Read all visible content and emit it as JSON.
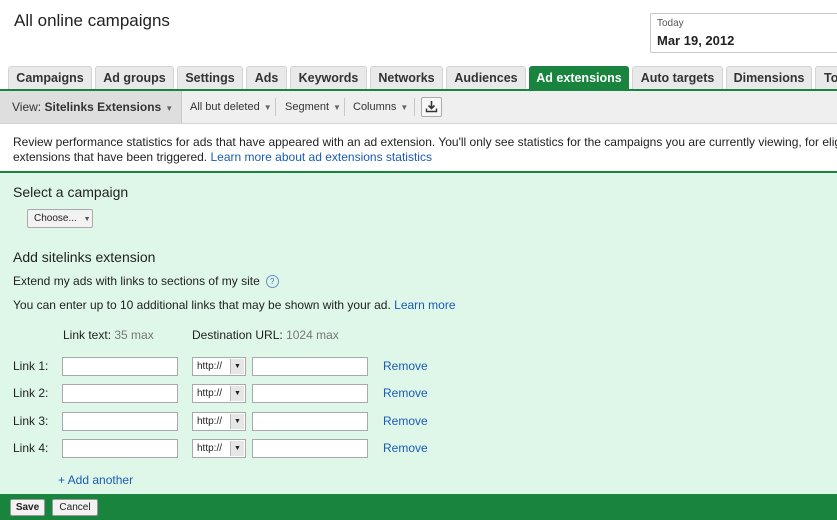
{
  "header": {
    "title": "All online campaigns",
    "date_label": "Today",
    "date_value": "Mar 19, 2012"
  },
  "tabs": [
    {
      "label": "Campaigns"
    },
    {
      "label": "Ad groups"
    },
    {
      "label": "Settings"
    },
    {
      "label": "Ads"
    },
    {
      "label": "Keywords"
    },
    {
      "label": "Networks"
    },
    {
      "label": "Audiences"
    },
    {
      "label": "Ad extensions",
      "active": true
    },
    {
      "label": "Auto targets"
    },
    {
      "label": "Dimensions"
    },
    {
      "label": "To"
    }
  ],
  "toolbar": {
    "view_prefix": "View:",
    "view_value": "Sitelinks Extensions",
    "filter": "All but deleted",
    "segment": "Segment",
    "columns": "Columns",
    "download_icon": "download-icon"
  },
  "info": {
    "line1": "Review performance statistics for ads that have appeared with an ad extension. You'll only see statistics for the campaigns you are currently viewing, for elig",
    "line2_text": "extensions that have been triggered.",
    "line2_link": "Learn more about ad extensions statistics"
  },
  "panel": {
    "select_heading": "Select a campaign",
    "choose_label": "Choose...",
    "add_heading": "Add sitelinks extension",
    "extend_text": "Extend my ads with links to sections of my site",
    "help_icon": "?",
    "enter_text": "You can enter up to 10 additional links that may be shown with your ad.",
    "enter_link": "Learn more",
    "link_text_header": "Link text:",
    "link_text_max": "35 max",
    "dest_url_header": "Destination URL:",
    "dest_url_max": "1024 max",
    "links": [
      {
        "label": "Link 1:",
        "text": "",
        "protocol": "http://",
        "url": "",
        "remove": "Remove"
      },
      {
        "label": "Link 2:",
        "text": "",
        "protocol": "http://",
        "url": "",
        "remove": "Remove"
      },
      {
        "label": "Link 3:",
        "text": "",
        "protocol": "http://",
        "url": "",
        "remove": "Remove"
      },
      {
        "label": "Link 4:",
        "text": "",
        "protocol": "http://",
        "url": "",
        "remove": "Remove"
      }
    ],
    "add_another": "+ Add another"
  },
  "footer": {
    "save": "Save",
    "cancel": "Cancel"
  },
  "colors": {
    "accent_green": "#19843e",
    "panel_bg": "#dff7e8",
    "link_blue": "#1a5bb8"
  }
}
